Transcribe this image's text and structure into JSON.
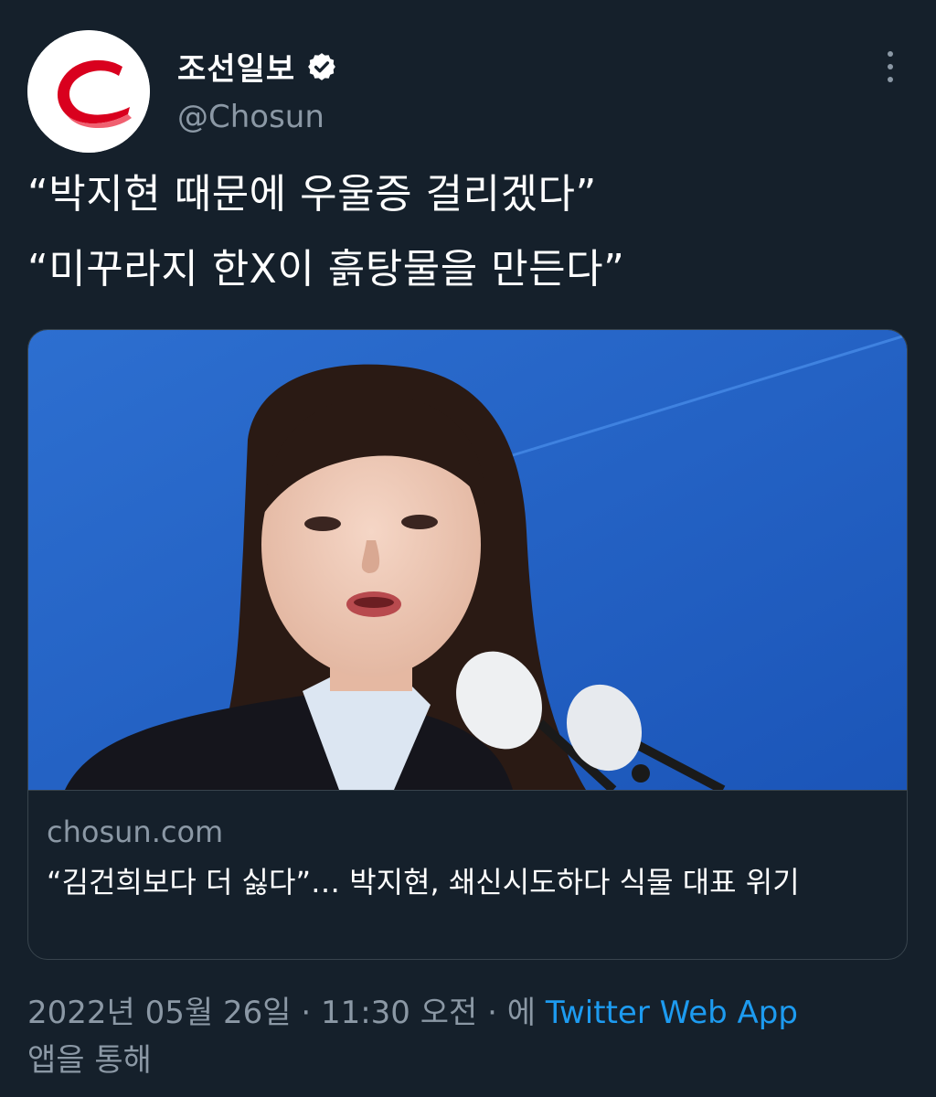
{
  "author": {
    "display_name": "조선일보",
    "handle": "@Chosun",
    "avatar_icon": "chosun-logo",
    "verified_icon": "verified-badge-icon"
  },
  "tweet": {
    "lines": [
      "“박지현 때문에 우울증 걸리겠다”",
      "“미꾸라지 한X이 흙탕물을 만든다”"
    ]
  },
  "card": {
    "domain": "chosun.com",
    "title": "“김건희보다 더 싫다”… 박지현, 쇄신시도하다 식물 대표 위기"
  },
  "meta": {
    "date": "2022년 05월 26일",
    "separator": " · ",
    "time": "11:30 오전",
    "via_prefix": "에 ",
    "source": "Twitter Web App",
    "via_suffix": "앱을 통해"
  },
  "colors": {
    "background": "#15202b",
    "muted_text": "#8b98a5",
    "link": "#1d9bf0",
    "logo_red": "#e4002b"
  }
}
